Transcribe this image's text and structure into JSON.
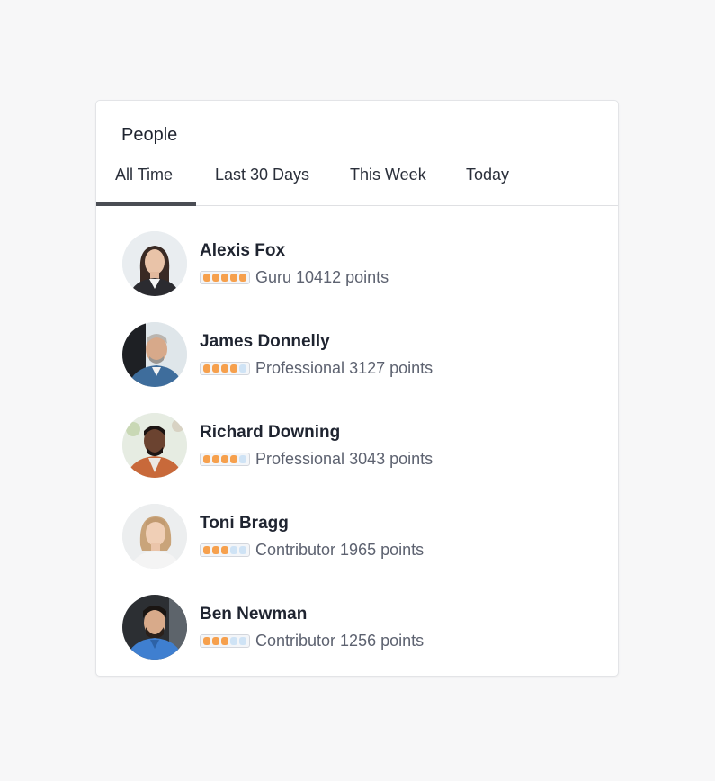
{
  "card": {
    "title": "People"
  },
  "tabs": [
    {
      "label": "All Time",
      "active": true
    },
    {
      "label": "Last 30 Days",
      "active": false
    },
    {
      "label": "This Week",
      "active": false
    },
    {
      "label": "Today",
      "active": false
    }
  ],
  "people": [
    {
      "name": "Alexis Fox",
      "rank": "Guru",
      "points": "10412",
      "points_unit": "points",
      "level": 5,
      "level_max": 5
    },
    {
      "name": "James Donnelly",
      "rank": "Professional",
      "points": "3127",
      "points_unit": "points",
      "level": 4,
      "level_max": 5
    },
    {
      "name": "Richard Downing",
      "rank": "Professional",
      "points": "3043",
      "points_unit": "points",
      "level": 4,
      "level_max": 5
    },
    {
      "name": "Toni Bragg",
      "rank": "Contributor",
      "points": "1965",
      "points_unit": "points",
      "level": 3,
      "level_max": 5
    },
    {
      "name": "Ben Newman",
      "rank": "Contributor",
      "points": "1256",
      "points_unit": "points",
      "level": 3,
      "level_max": 5
    }
  ],
  "colors": {
    "level_on": "#f6a04d",
    "level_off": "#cfe3f5",
    "tab_indicator": "#4a4d54"
  },
  "icons": {
    "avatar": "user-avatar-photo"
  }
}
